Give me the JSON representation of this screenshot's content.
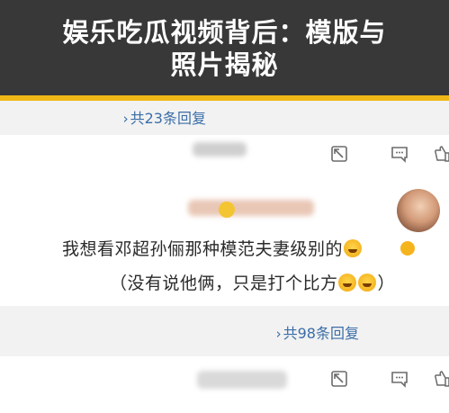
{
  "banner": {
    "line1": "娱乐吃瓜视频背后：模版与",
    "line2": "照片揭秘",
    "stripe_color": "#f0b816"
  },
  "thread": {
    "top_reply_count": "共23条回复",
    "second_reply_count": "共98条回复",
    "comment_line1": "我想看邓超孙俪那种模范夫妻级别的",
    "comment_line2": "（没有说他俩，只是打个比方",
    "accent": "#3b6ea8"
  },
  "icons": [
    "share-icon",
    "comment-icon",
    "like-icon",
    "avatar",
    "verified-badge-icon",
    "laugh-emoji-icon"
  ]
}
